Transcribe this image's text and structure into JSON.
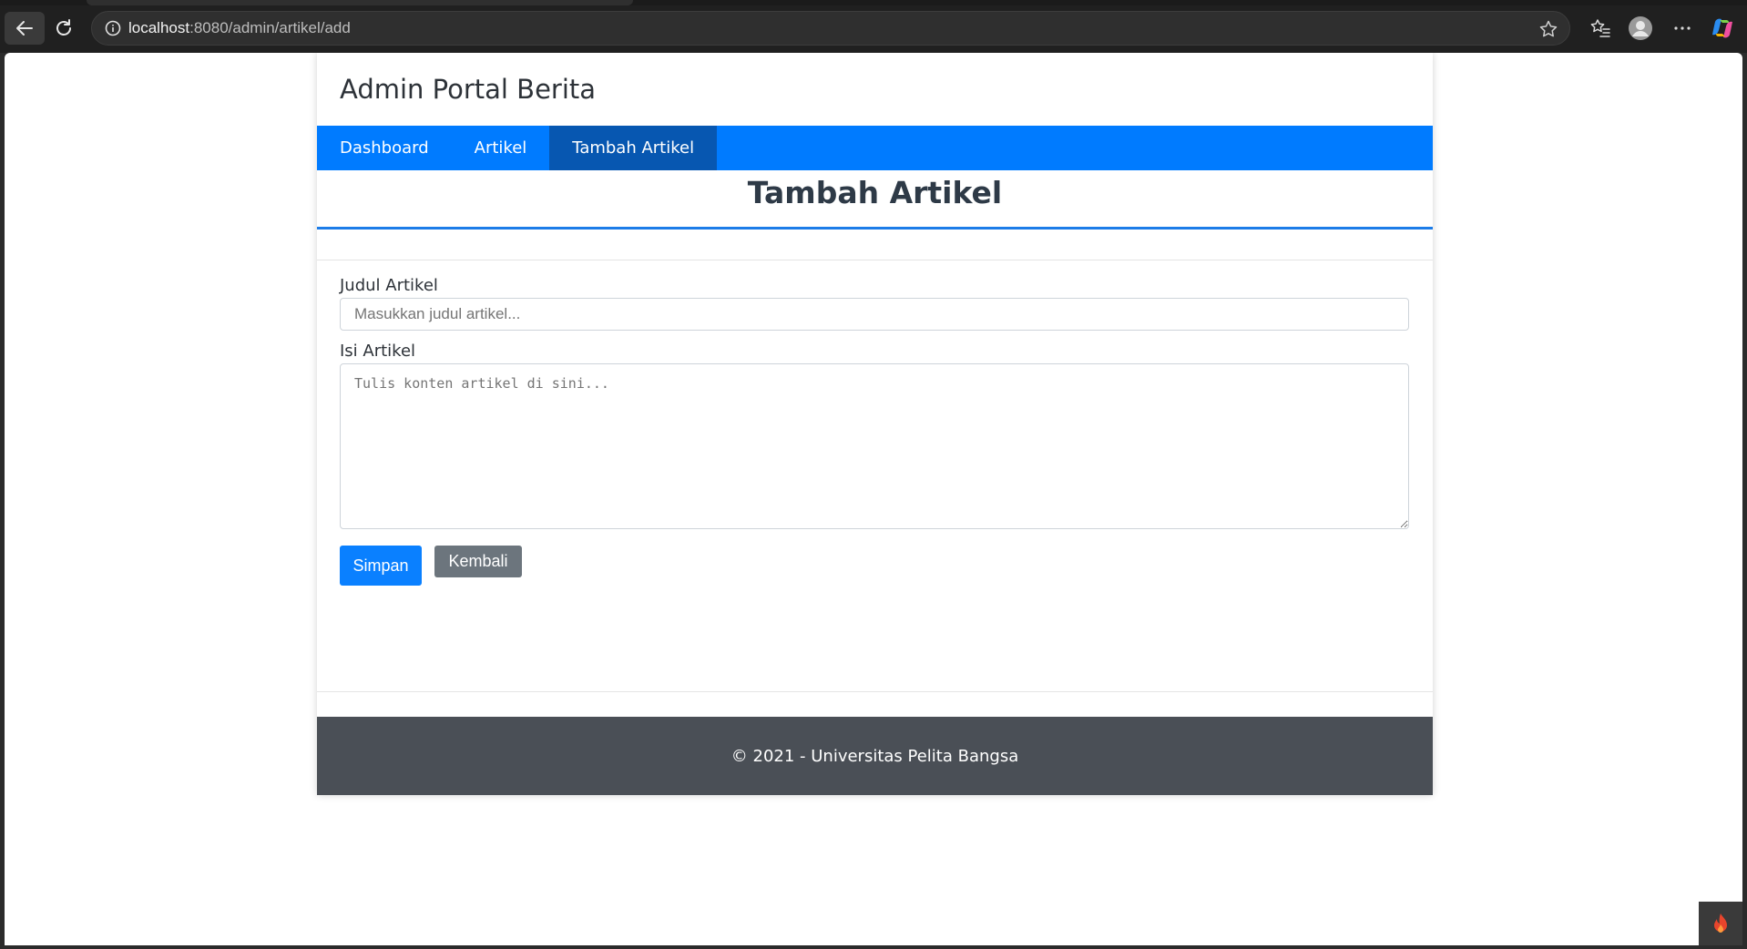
{
  "browser": {
    "url_host": "localhost",
    "url_rest": ":8080/admin/artikel/add"
  },
  "site": {
    "title": "Admin Portal Berita"
  },
  "nav": {
    "items": [
      {
        "label": "Dashboard",
        "active": false
      },
      {
        "label": "Artikel",
        "active": false
      },
      {
        "label": "Tambah Artikel",
        "active": true
      }
    ]
  },
  "page": {
    "heading": "Tambah Artikel"
  },
  "form": {
    "title_label": "Judul Artikel",
    "title_placeholder": "Masukkan judul artikel...",
    "title_value": "",
    "content_label": "Isi Artikel",
    "content_placeholder": "Tulis konten artikel di sini...",
    "content_value": "",
    "save_label": "Simpan",
    "back_label": "Kembali"
  },
  "footer": {
    "text": "© 2021 - Universitas Pelita Bangsa"
  },
  "colors": {
    "nav_bg": "#007bff",
    "nav_active": "#0757b1",
    "primary_button": "#0a80ff",
    "secondary_button": "#6c757d",
    "footer_bg": "#4a4f56"
  },
  "icons": {
    "back": "arrow-left-icon",
    "reload": "reload-icon",
    "info": "info-icon",
    "favorite": "star-icon",
    "favorites_list": "favorites-icon",
    "profile": "profile-icon",
    "more": "more-icon",
    "copilot": "copilot-icon",
    "devtool": "flame-icon"
  }
}
